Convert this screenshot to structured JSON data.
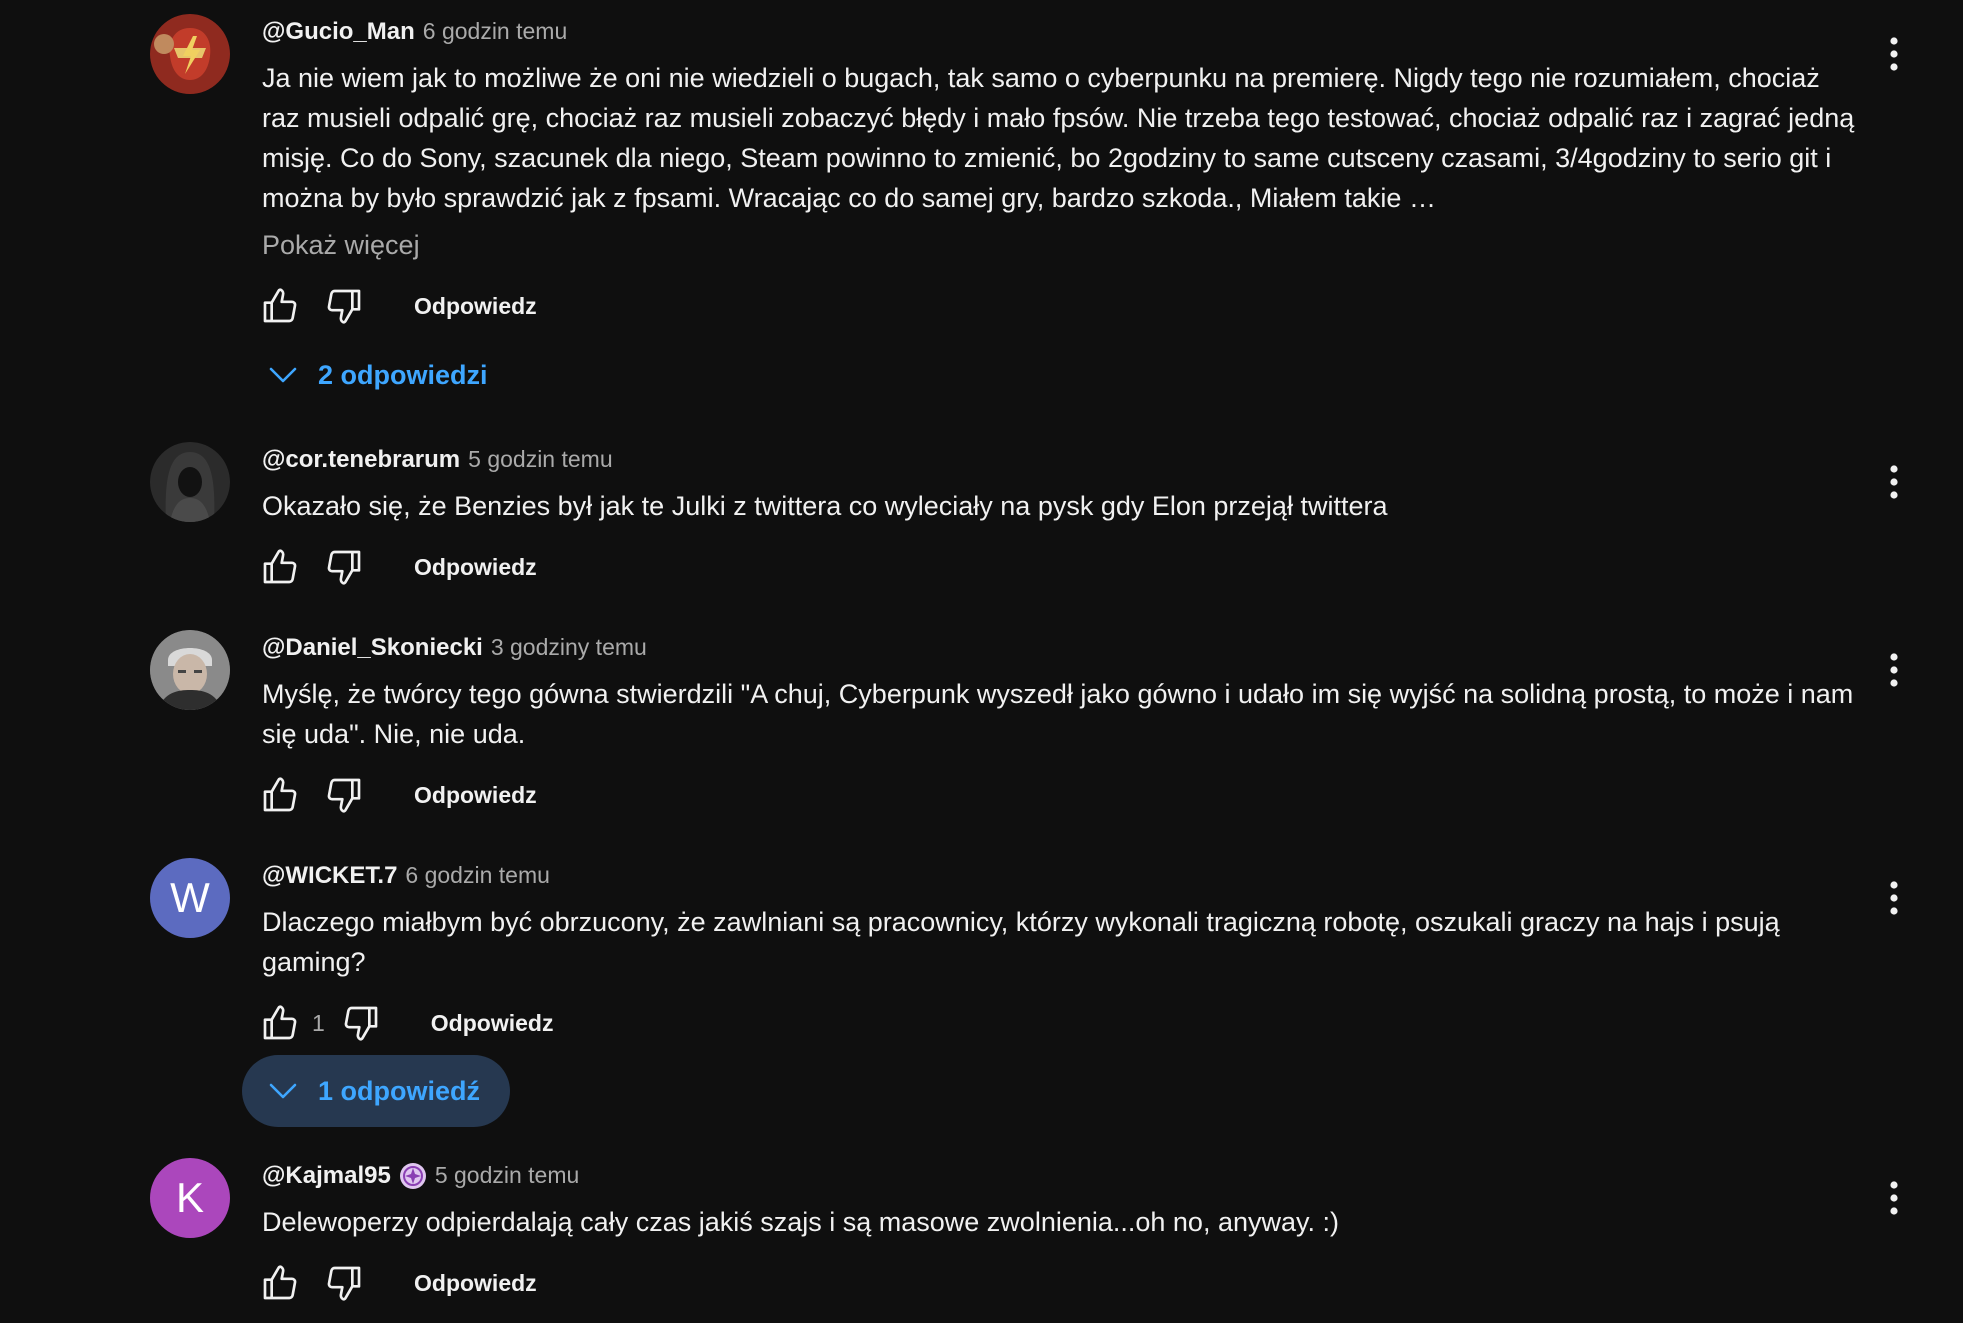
{
  "labels": {
    "reply": "Odpowiedz",
    "show_more": "Pokaż więcej"
  },
  "colors": {
    "background": "#0f0f0f",
    "text": "#f1f1f1",
    "secondary_text": "#aaaaaa",
    "link_blue": "#3ea6ff",
    "replies_highlight_bg": "#263850"
  },
  "icons": {
    "like": "thumb-up-icon",
    "dislike": "thumb-down-icon",
    "menu": "more-vert-icon",
    "expand": "chevron-down-icon",
    "badge": "member-badge-icon"
  },
  "comments": [
    {
      "author": "@Gucio_Man",
      "time": "6 godzin temu",
      "avatar": "profile-image",
      "text": "Ja nie wiem jak to możliwe że oni nie wiedzieli o bugach, tak samo o cyberpunku na premierę. Nigdy tego nie rozumiałem, chociaż raz musieli odpalić grę, chociaż raz musieli zobaczyć błędy i mało fpsów. Nie trzeba tego testować, chociaż odpalić raz i zagrać jedną misję. Co do Sony, szacunek dla niego, Steam powinno to zmienić, bo 2godziny to same cutsceny czasami, 3/4godziny to serio git i można by było sprawdzić jak z fpsami. Wracając co do samej gry, bardzo szkoda., Miałem takie …",
      "likes": "",
      "replies_label": "2 odpowiedzi"
    },
    {
      "author": "@cor.tenebrarum",
      "time": "5 godzin temu",
      "avatar": "profile-image",
      "text": "Okazało się, że Benzies był jak te Julki z twittera co wyleciały na pysk gdy Elon przejął twittera",
      "likes": ""
    },
    {
      "author": "@Daniel_Skoniecki",
      "time": "3 godziny temu",
      "avatar": "profile-image",
      "text": "Myślę, że twórcy tego gówna stwierdzili \"A chuj, Cyberpunk wyszedł jako gówno i udało im się wyjść na solidną prostą, to może i nam się uda\". Nie, nie uda.",
      "likes": ""
    },
    {
      "author": "@WICKET.7",
      "time": "6 godzin temu",
      "avatar_letter": "W",
      "text": "Dlaczego miałbym być obrzucony, że zawlniani są pracownicy, którzy wykonali tragiczną robotę, oszukali graczy na hajs i psują gaming?",
      "likes": "1",
      "replies_label": "1 odpowiedź"
    },
    {
      "author": "@Kajmal95",
      "time": "5 godzin temu",
      "avatar_letter": "K",
      "has_badge": true,
      "text": "Delewoperzy odpierdalają cały czas jakiś szajs i są masowe zwolnienia...oh no, anyway. :)",
      "likes": ""
    }
  ]
}
